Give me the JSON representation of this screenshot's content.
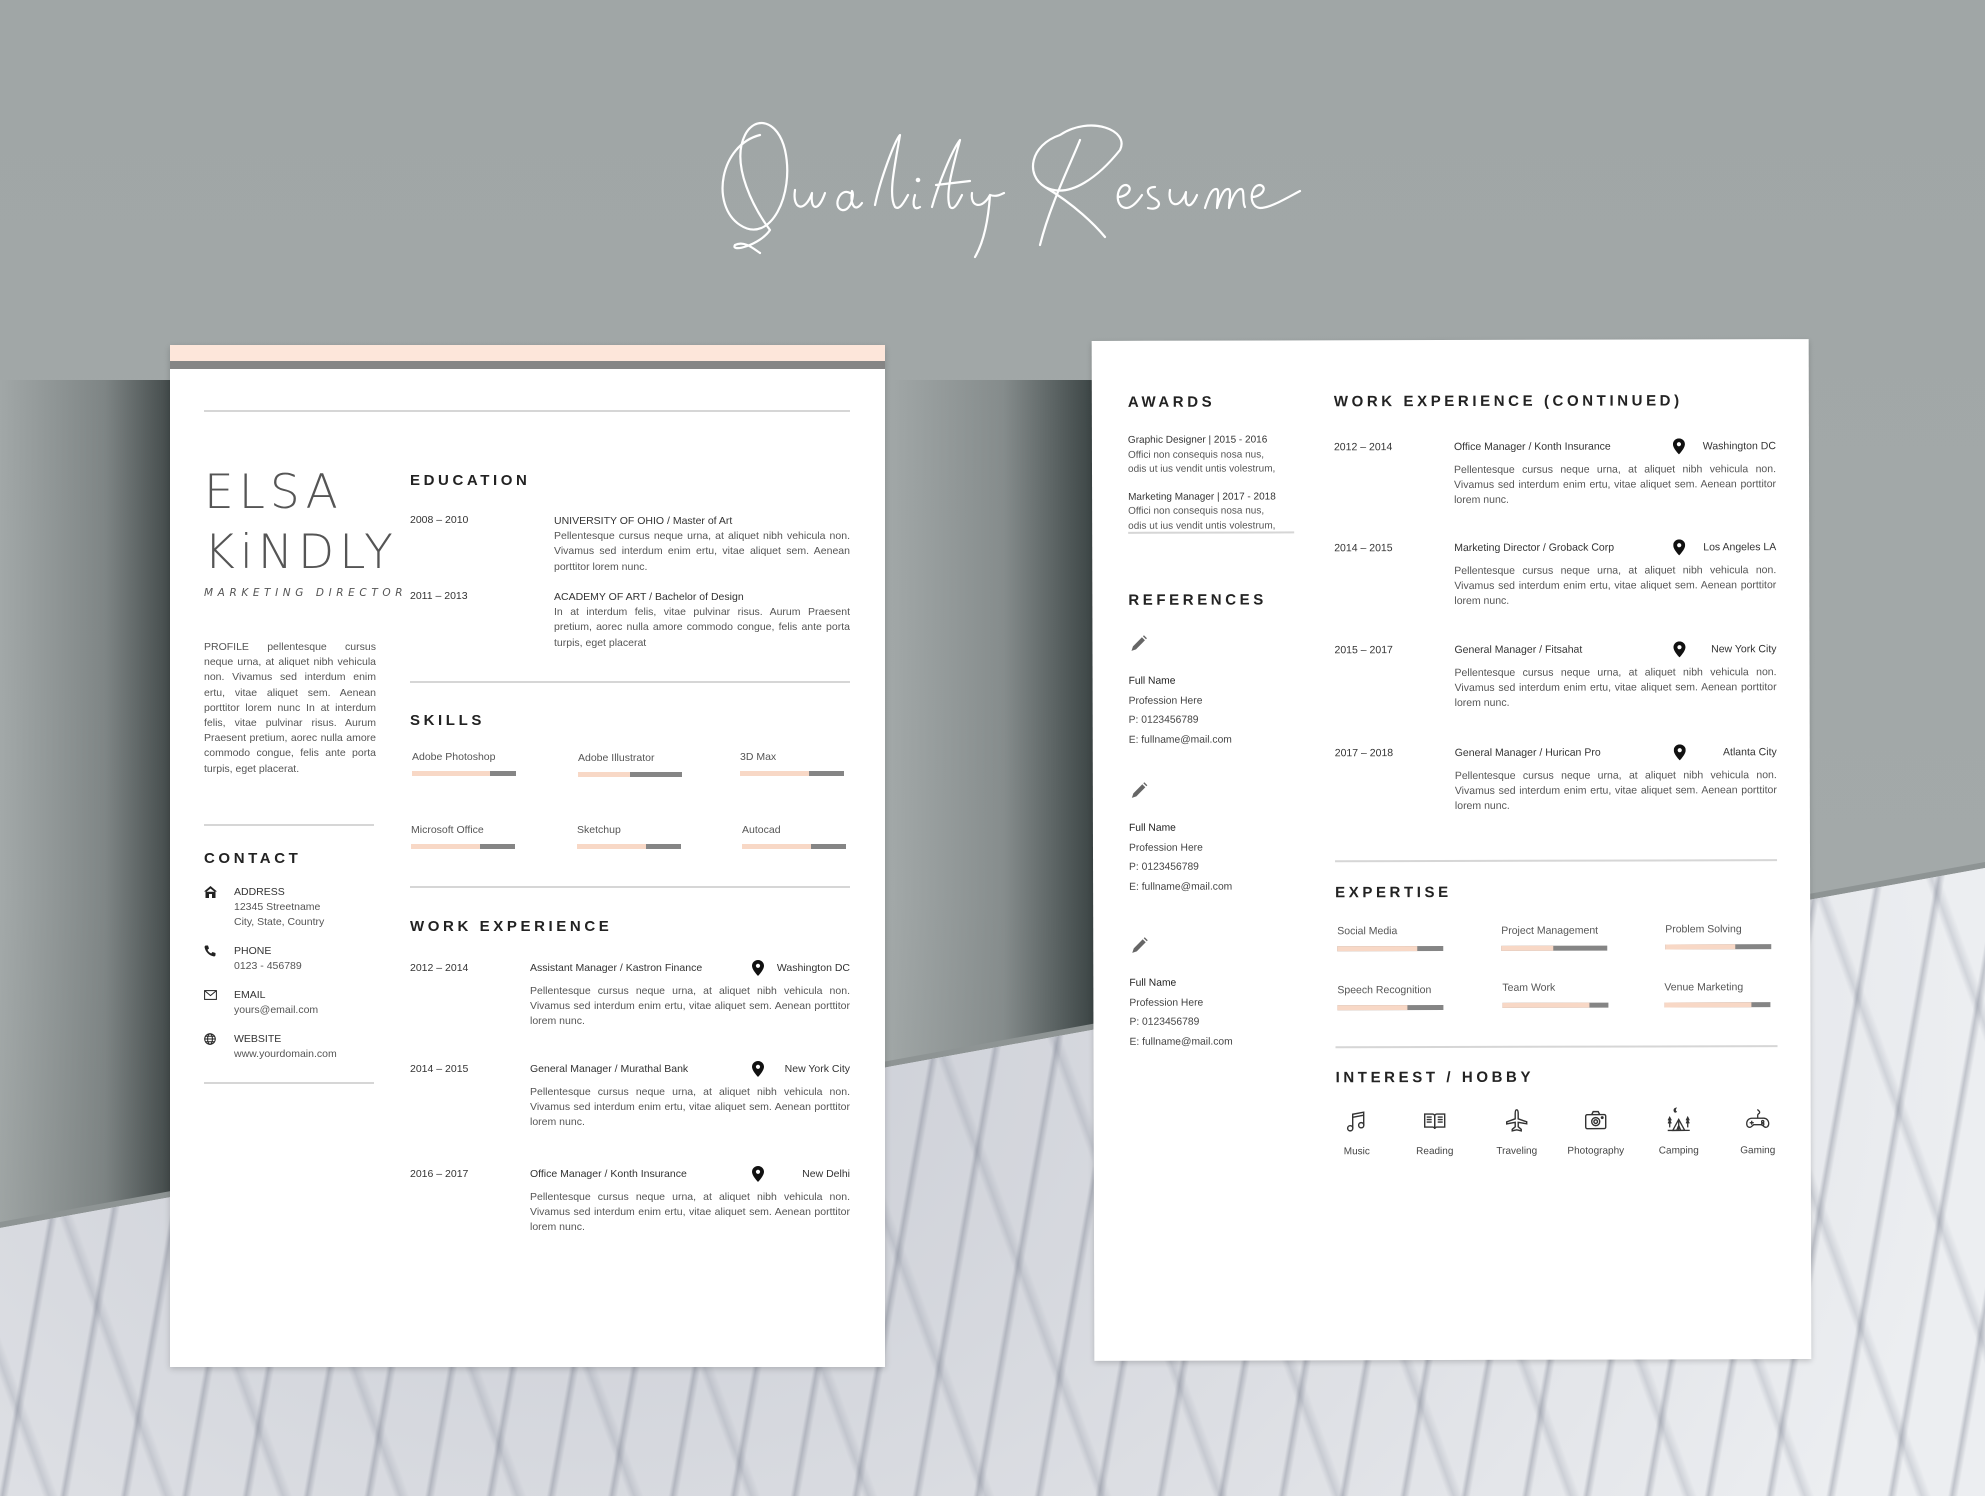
{
  "banner": {
    "title": "Quality Resume"
  },
  "colors": {
    "accent_peach": "#f8d8c6",
    "band_peach": "#fde6da",
    "band_gray": "#858585",
    "bar_gray": "#858585"
  },
  "left_page": {
    "name_first": "ELSA",
    "name_last": "KiNDLY",
    "role": "MARKETING DIRECTOR",
    "profile": "PROFILE pellentesque cursus neque urna, at aliquet nibh vehicula non. Vivamus sed interdum enim ertu, vitae aliquet sem. Aenean porttitor lorem nunc In at interdum felis, vitae pulvinar risus. Aurum Praesent pretium, aorec nulla amore commodo congue, felis ante porta turpis, eget placerat.",
    "contact": {
      "heading": "CONTACT",
      "items": [
        {
          "icon": "home-icon",
          "label": "ADDRESS",
          "lines": [
            "12345 Streetname",
            "City, State, Country"
          ]
        },
        {
          "icon": "phone-icon",
          "label": "PHONE",
          "lines": [
            "0123 - 456789"
          ]
        },
        {
          "icon": "mail-icon",
          "label": "EMAIL",
          "lines": [
            "yours@email.com"
          ]
        },
        {
          "icon": "globe-icon",
          "label": "WEBSITE",
          "lines": [
            "www.yourdomain.com"
          ]
        }
      ]
    },
    "education": {
      "heading": "EDUCATION",
      "items": [
        {
          "years": "2008 – 2010",
          "title": "UNIVERSITY OF OHIO / Master of Art",
          "description": "Pellentesque cursus neque urna, at aliquet nibh vehicula non. Vivamus sed interdum enim ertu, vitae aliquet sem. Aenean porttitor lorem nunc."
        },
        {
          "years": "2011 – 2013",
          "title": "ACADEMY OF ART / Bachelor of Design",
          "description": "In at interdum felis, vitae pulvinar risus. Aurum Praesent pretium, aorec nulla amore commodo congue, felis ante porta turpis, eget placerat"
        }
      ]
    },
    "skills": {
      "heading": "SKILLS",
      "items": [
        {
          "label": "Adobe Photoshop",
          "level": 0.75
        },
        {
          "label": "Adobe Illustrator",
          "level": 0.5
        },
        {
          "label": "3D Max",
          "level": 0.66
        },
        {
          "label": "Microsoft Office",
          "level": 0.66
        },
        {
          "label": "Sketchup",
          "level": 0.66
        },
        {
          "label": "Autocad",
          "level": 0.66
        }
      ]
    },
    "work": {
      "heading": "WORK EXPERIENCE",
      "items": [
        {
          "years": "2012 – 2014",
          "title": "Assistant Manager / Kastron Finance",
          "location": "Washington DC",
          "description": "Pellentesque cursus neque urna, at aliquet nibh vehicula non. Vivamus sed interdum enim ertu, vitae aliquet sem. Aenean porttitor lorem nunc."
        },
        {
          "years": "2014 – 2015",
          "title": "General Manager / Murathal Bank",
          "location": "New York City",
          "description": "Pellentesque cursus neque urna, at aliquet nibh vehicula non. Vivamus sed interdum enim ertu, vitae aliquet sem. Aenean porttitor lorem nunc."
        },
        {
          "years": "2016 – 2017",
          "title": "Office Manager / Konth Insurance",
          "location": "New Delhi",
          "description": "Pellentesque cursus neque urna, at aliquet nibh vehicula non. Vivamus sed interdum enim ertu, vitae aliquet sem. Aenean porttitor lorem nunc."
        }
      ]
    }
  },
  "right_page": {
    "awards": {
      "heading": "AWARDS",
      "items": [
        {
          "title": "Graphic Designer | 2015 - 2016",
          "lines": [
            "Offici non consequis nosa nus,",
            "odis ut ius vendit untis volestrum,"
          ]
        },
        {
          "title": "Marketing Manager | 2017 - 2018",
          "lines": [
            "Offici non consequis nosa nus,",
            "odis ut ius vendit untis volestrum,"
          ]
        }
      ]
    },
    "references": {
      "heading": "REFERENCES",
      "items": [
        {
          "name": "Full Name",
          "profession": "Profession Here",
          "phone": "P: 0123456789",
          "email": "E: fullname@mail.com"
        },
        {
          "name": "Full Name",
          "profession": "Profession Here",
          "phone": "P: 0123456789",
          "email": "E: fullname@mail.com"
        },
        {
          "name": "Full Name",
          "profession": "Profession Here",
          "phone": "P: 0123456789",
          "email": "E: fullname@mail.com"
        }
      ]
    },
    "work": {
      "heading": "WORK EXPERIENCE (CONTINUED)",
      "items": [
        {
          "years": "2012 – 2014",
          "title": "Office Manager / Konth Insurance",
          "location": "Washington DC",
          "description": "Pellentesque cursus neque urna, at aliquet nibh vehicula non. Vivamus sed interdum enim ertu, vitae aliquet sem. Aenean porttitor lorem nunc."
        },
        {
          "years": "2014 – 2015",
          "title": "Marketing Director / Groback Corp",
          "location": "Los Angeles LA",
          "description": "Pellentesque cursus neque urna, at aliquet nibh vehicula non. Vivamus sed interdum enim ertu, vitae aliquet sem. Aenean porttitor lorem nunc."
        },
        {
          "years": "2015 – 2017",
          "title": "General Manager / Fitsahat",
          "location": "New York City",
          "description": "Pellentesque cursus neque urna, at aliquet nibh vehicula non. Vivamus sed interdum enim ertu, vitae aliquet sem. Aenean porttitor lorem nunc."
        },
        {
          "years": "2017 – 2018",
          "title": "General Manager / Hurican Pro",
          "location": "Atlanta City",
          "description": "Pellentesque cursus neque urna, at aliquet nibh vehicula non. Vivamus sed interdum enim ertu, vitae aliquet sem. Aenean porttitor lorem nunc."
        }
      ]
    },
    "expertise": {
      "heading": "EXPERTISE",
      "items": [
        {
          "label": "Social Media",
          "level": 0.75
        },
        {
          "label": "Project Management",
          "level": 0.49
        },
        {
          "label": "Problem Solving",
          "level": 0.66
        },
        {
          "label": "Speech Recognition",
          "level": 0.66
        },
        {
          "label": "Team Work",
          "level": 0.82
        },
        {
          "label": "Venue Marketing",
          "level": 0.82
        }
      ]
    },
    "hobbies": {
      "heading": "INTEREST / HOBBY",
      "items": [
        {
          "label": "Music",
          "icon": "music-note-icon"
        },
        {
          "label": "Reading",
          "icon": "book-icon"
        },
        {
          "label": "Traveling",
          "icon": "airplane-icon"
        },
        {
          "label": "Photography",
          "icon": "camera-icon"
        },
        {
          "label": "Camping",
          "icon": "tent-icon"
        },
        {
          "label": "Gaming",
          "icon": "gamepad-icon"
        }
      ]
    }
  }
}
